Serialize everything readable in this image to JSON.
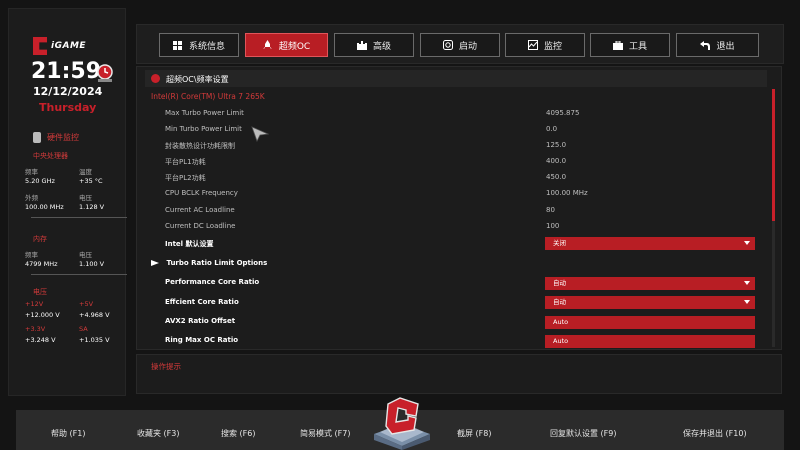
{
  "brand": {
    "name": "iGAME"
  },
  "status": {
    "time": "21:59",
    "date": "12/12/2024",
    "weekday": "Thursday"
  },
  "hardware": {
    "title": "硬件监控",
    "cpu": {
      "title": "中央处理器",
      "freq_label": "频率",
      "freq_value": "5.20 GHz",
      "temp_label": "温度",
      "temp_value": "+35 °C",
      "ext_label": "外频",
      "ext_value": "100.00 MHz",
      "volt_label": "电压",
      "volt_value": "1.128 V"
    },
    "memory": {
      "title": "内存",
      "freq_label": "频率",
      "freq_value": "4799 MHz",
      "volt_label": "电压",
      "volt_value": "1.100 V"
    },
    "voltage": {
      "title": "电压",
      "v12_label": "+12V",
      "v12_value": "+12.000 V",
      "v5_label": "+5V",
      "v5_value": "+4.968 V",
      "v33_label": "+3.3V",
      "v33_value": "+3.248 V",
      "soc_label": "SA",
      "soc_value": "+1.035 V"
    }
  },
  "tabs": [
    {
      "label": "系统信息",
      "icon": "grid-icon"
    },
    {
      "label": "超频OC",
      "icon": "rocket-icon",
      "active": true
    },
    {
      "label": "高级",
      "icon": "castle-icon"
    },
    {
      "label": "启动",
      "icon": "power-icon"
    },
    {
      "label": "监控",
      "icon": "chart-icon"
    },
    {
      "label": "工具",
      "icon": "toolbox-icon"
    },
    {
      "label": "退出",
      "icon": "back-arrow-icon"
    }
  ],
  "main": {
    "breadcrumb": "超频OC\\频率设置",
    "cpu_name": "Intel(R) Core(TM) Ultra 7 265K",
    "rows": [
      {
        "label": "Max Turbo Power Limit",
        "value": "4095.875"
      },
      {
        "label": "Min Turbo Power Limit",
        "value": "0.0"
      },
      {
        "label": "封装散热设计功耗限制",
        "value": "125.0"
      },
      {
        "label": "平台PL1功耗",
        "value": "400.0"
      },
      {
        "label": "平台PL2功耗",
        "value": "450.0"
      },
      {
        "label": "CPU BCLK Frequency",
        "value": "100.00 MHz"
      },
      {
        "label": "Current AC Loadline",
        "value": "80"
      },
      {
        "label": "Current DC Loadline",
        "value": "100"
      }
    ],
    "intel_default": {
      "label": "Intel 默认设置",
      "value": "关闭"
    },
    "submenu": "Turbo Ratio Limit Options",
    "ratio_rows": [
      {
        "label": "Performance Core Ratio",
        "value": "自动",
        "dropdown": true
      },
      {
        "label": "Effcient Core Ratio",
        "value": "自动",
        "dropdown": true
      },
      {
        "label": "AVX2 Ratio Offset",
        "value": "Auto",
        "dropdown": false
      },
      {
        "label": "Ring Max OC Ratio",
        "value": "Auto",
        "dropdown": false
      }
    ]
  },
  "hint": {
    "title": "操作提示"
  },
  "footer": [
    {
      "label": "帮助 (F1)"
    },
    {
      "label": "收藏夹 (F3)"
    },
    {
      "label": "搜索 (F6)"
    },
    {
      "label": "简易模式 (F7)"
    },
    {
      "label": "截屏 (F8)"
    },
    {
      "label": "回复默认设置 (F9)"
    },
    {
      "label": "保存并退出 (F10)"
    }
  ],
  "colors": {
    "accent": "#b81e24",
    "background": "#141414",
    "panel": "#1c1c1c"
  }
}
